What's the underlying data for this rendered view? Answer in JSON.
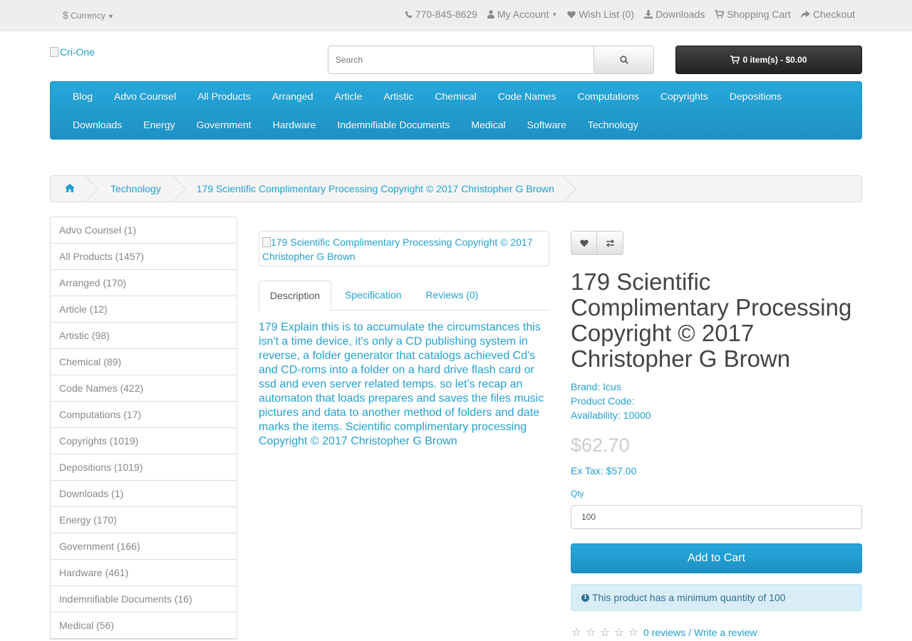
{
  "topbar": {
    "currency_symbol": "$",
    "currency_label": "Currency",
    "phone": "770-845-8629",
    "my_account": "My Account",
    "wish_list": "Wish List (0)",
    "downloads": "Downloads",
    "shopping_cart": "Shopping Cart",
    "checkout": "Checkout"
  },
  "header": {
    "logo_alt": "Cri-One",
    "search_placeholder": "Search",
    "cart_label": "0 item(s) - $0.00"
  },
  "menu": {
    "items": [
      "Blog",
      "Advo Counsel",
      "All Products",
      "Arranged",
      "Article",
      "Artistic",
      "Chemical",
      "Code Names",
      "Computations",
      "Copyrights",
      "Depositions",
      "Downloads",
      "Energy",
      "Government",
      "Hardware",
      "Indemnifiable Documents",
      "Medical",
      "Software",
      "Technology"
    ]
  },
  "breadcrumb": {
    "items": [
      "Technology",
      "179 Scientific Complimentary Processing Copyright © 2017 Christopher G Brown"
    ]
  },
  "sidebar": {
    "categories": [
      "Advo Counsel (1)",
      "All Products (1457)",
      "Arranged (170)",
      "Article (12)",
      "Artistic (98)",
      "Chemical (89)",
      "Code Names (422)",
      "Computations (17)",
      "Copyrights (1019)",
      "Depositions (1019)",
      "Downloads (1)",
      "Energy (170)",
      "Government (166)",
      "Hardware (461)",
      "Indemnifiable Documents (16)",
      "Medical (56)"
    ]
  },
  "product": {
    "image_alt": "179 Scientific Complimentary Processing Copyright © 2017 Christopher G Brown",
    "tabs": [
      "Description",
      "Specification",
      "Reviews (0)"
    ],
    "description": "179 Explain this is to accumulate the circumstances this isn't a time device, it's only a CD publishing system in reverse, a folder generator that catalogs achieved Cd's and CD-roms into a folder on a hard drive flash card or ssd and even server related temps. so let's recap an automaton that loads prepares and saves the files music pictures and data to another method of folders and date marks the items. Scientific complimentary processing Copyright © 2017 Christopher G Brown",
    "title": "179 Scientific Complimentary Processing Copyright © 2017 Christopher G Brown",
    "brand": "Brand: Icus",
    "product_code": "Product Code:",
    "availability": "Availability: 10000",
    "price": "$62.70",
    "ex_tax": "Ex Tax: $57.00",
    "qty_label": "Qty",
    "qty_value": "100",
    "add_to_cart": "Add to Cart",
    "min_qty_alert": "This product has a minimum quantity of 100",
    "reviews_link": "0 reviews",
    "review_sep": " / ",
    "write_review": "Write a review",
    "rating_stars": 0
  },
  "colors": {
    "accent": "#23a1d1",
    "menu_bg": "#229ac8",
    "cart_bg": "#303030",
    "alert_bg": "#d9edf7"
  }
}
